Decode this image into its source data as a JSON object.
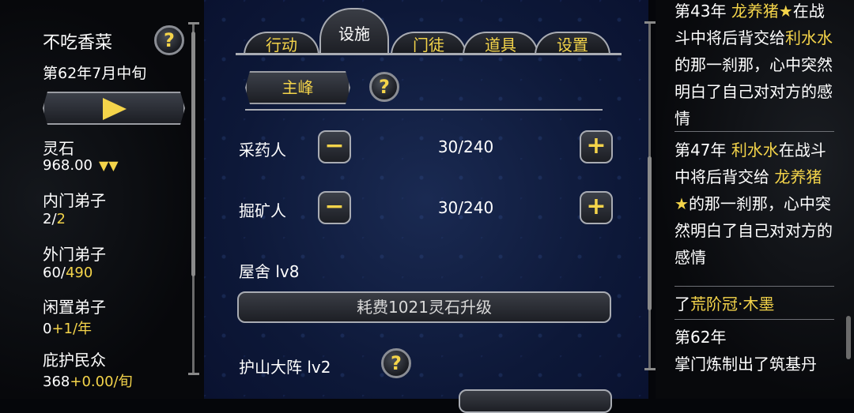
{
  "left": {
    "sect_name": "不吃香菜",
    "date": "第62年7月中旬",
    "help_icon": "?",
    "stats": [
      {
        "label": "灵石",
        "value": "968.00",
        "arrows": "▼▼"
      },
      {
        "label": "内门弟子",
        "value_a": "2/",
        "value_b": "2"
      },
      {
        "label": "外门弟子",
        "value_a": "60/",
        "value_b": "490"
      },
      {
        "label": "闲置弟子",
        "value_a": "0",
        "value_b": "+1/年"
      },
      {
        "label": "庇护民众",
        "value_a": "368",
        "value_b": "+0.00/旬"
      }
    ]
  },
  "tabs": {
    "action": "行动",
    "facilities": "设施",
    "disciples": "门徒",
    "items": "道具",
    "settings": "设置"
  },
  "facilities": {
    "peak_button": "主峰",
    "help_icon": "?",
    "herb_label": "采药人",
    "herb_count": "30/240",
    "mine_label": "掘矿人",
    "mine_count": "30/240",
    "minus": "−",
    "plus": "+",
    "house_label": "屋舍 lv8",
    "upgrade_button": "耗费1021灵石升级",
    "array_label": "护山大阵 lv2"
  },
  "log": {
    "entry1": {
      "year": "第43年 ",
      "name1": "龙养猪★",
      "mid1": "在战斗中将后背交给",
      "name2": "利水水",
      "mid2": "的那一刹那，心中突然明白了自己对对方的感情"
    },
    "entry2": {
      "year": "第47年 ",
      "name1": "利水水",
      "mid1": "在战斗中将后背交给 ",
      "name2": "龙养猪★",
      "mid2": "的那一刹那，心中突然明白了自己对对方的感情"
    },
    "entry3": {
      "prefix": "了",
      "name": "荒阶冠·木墨"
    },
    "entry4": {
      "year": "第62年",
      "text": "掌门炼制出了筑基丹"
    }
  }
}
